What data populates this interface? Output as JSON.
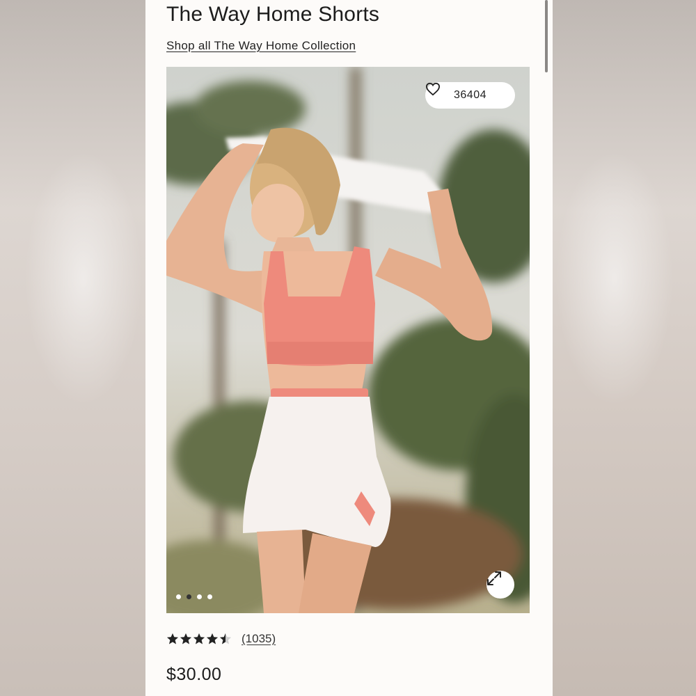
{
  "product": {
    "title": "The Way Home Shorts",
    "collection_link": "Shop all The Way Home Collection",
    "likes": "36404",
    "rating": 4.5,
    "review_count": "(1035)",
    "price": "$30.00"
  },
  "gallery": {
    "image_count": 4,
    "active_index": 1
  },
  "icons": {
    "likes": "heart-icon",
    "expand": "expand-icon",
    "rating": "star-icon"
  },
  "colors": {
    "page_bg": "#fdfbf9",
    "text": "#1c1c1c",
    "top": "#ee8a7c",
    "shorts": "#f6f1ee"
  }
}
